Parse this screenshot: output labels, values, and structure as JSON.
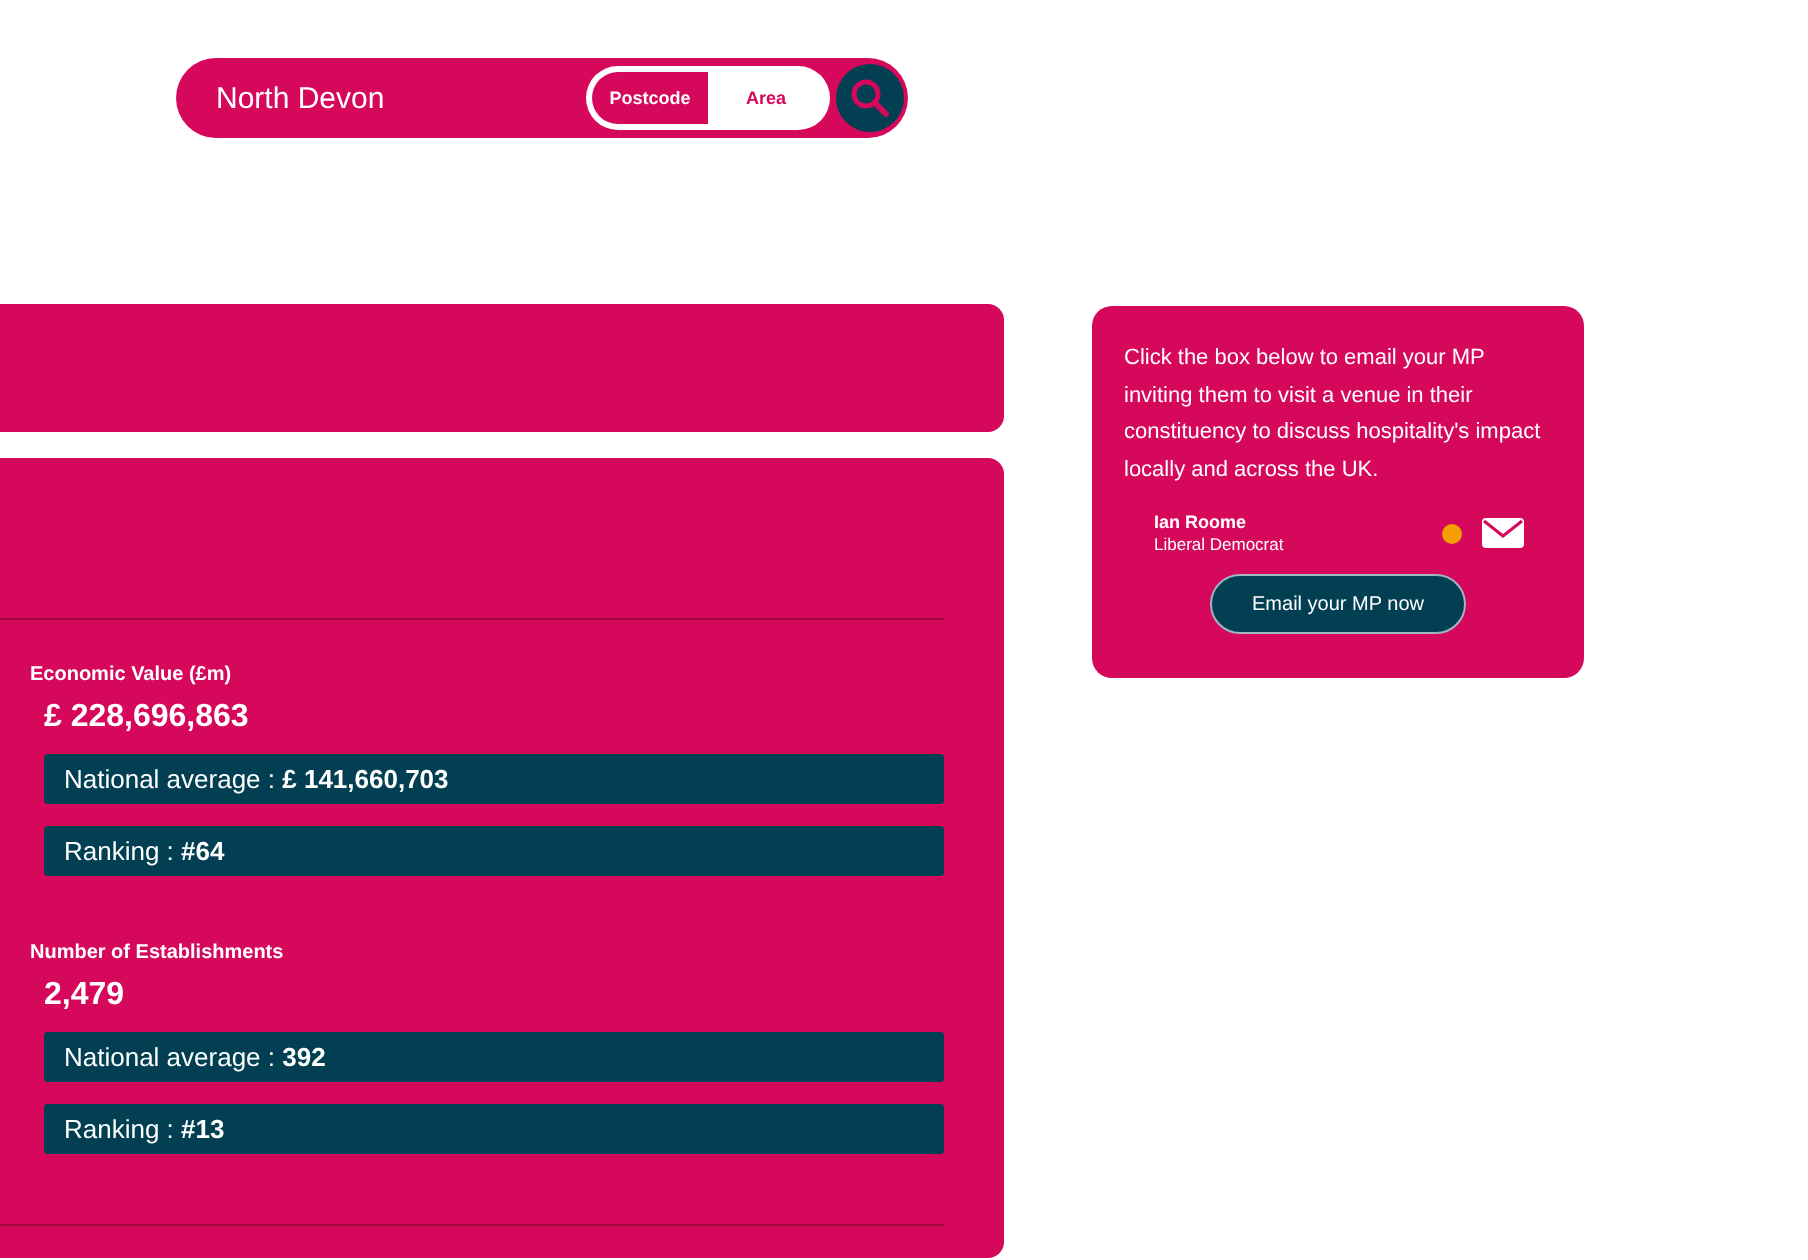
{
  "search": {
    "value": "North Devon",
    "modes": [
      {
        "label": "Postcode",
        "selected": true
      },
      {
        "label": "Area",
        "selected": false
      }
    ]
  },
  "metrics": [
    {
      "label": "Economic Value (£m)",
      "value": "£ 228,696,863",
      "rows": [
        "National average : **£ 141,660,703**",
        "Ranking : **#64**"
      ]
    },
    {
      "label": "Number of Establishments",
      "value": "2,479",
      "rows": [
        "National average : **392**",
        "Ranking : **#13**"
      ]
    }
  ],
  "mp_card": {
    "text": "Click the box below to email your MP inviting them to visit a venue in their constituency to discuss hospitality's impact locally and across the UK.",
    "name": "Ian Roome",
    "party": "Liberal Democrat",
    "color": "#f5a000",
    "button": "Email your MP now"
  }
}
